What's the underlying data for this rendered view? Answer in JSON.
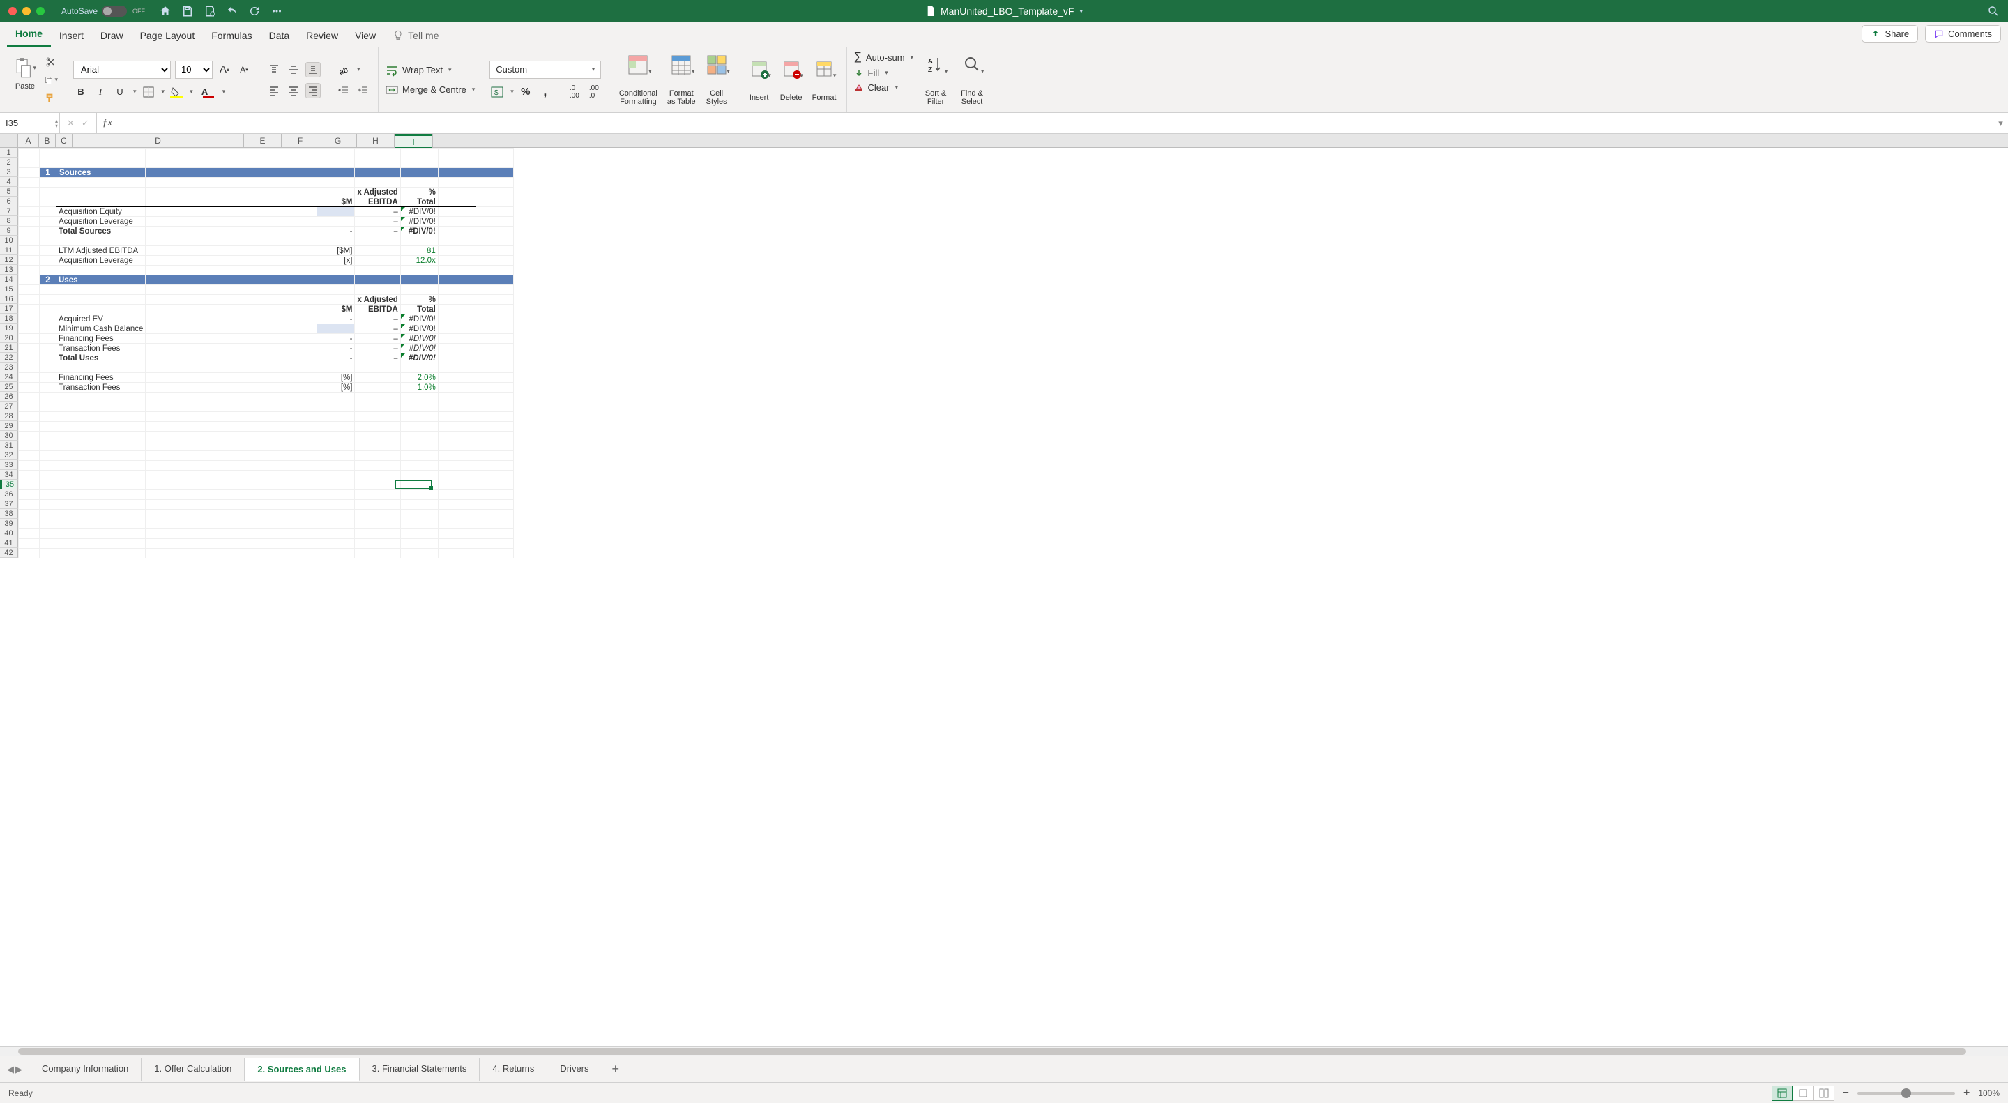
{
  "title_bar": {
    "autosave_label": "AutoSave",
    "autosave_state": "OFF",
    "doc_name": "ManUnited_LBO_Template_vF"
  },
  "menu": {
    "items": [
      "Home",
      "Insert",
      "Draw",
      "Page Layout",
      "Formulas",
      "Data",
      "Review",
      "View"
    ],
    "active_index": 0,
    "tell_me": "Tell me",
    "share": "Share",
    "comments": "Comments"
  },
  "ribbon": {
    "paste": "Paste",
    "font_name": "Arial",
    "font_size": "10",
    "wrap_text": "Wrap Text",
    "merge_centre": "Merge & Centre",
    "number_format": "Custom",
    "cond_fmt": "Conditional\nFormatting",
    "fmt_table": "Format\nas Table",
    "cell_styles": "Cell\nStyles",
    "insert": "Insert",
    "delete": "Delete",
    "format": "Format",
    "autosum": "Auto-sum",
    "fill": "Fill",
    "clear": "Clear",
    "sort": "Sort &\nFilter",
    "find": "Find &\nSelect"
  },
  "name_box": "I35",
  "columns": [
    "A",
    "B",
    "C",
    "D",
    "E",
    "F",
    "G",
    "H",
    "I"
  ],
  "col_widths": {
    "A": 30,
    "B": 24,
    "C": 24,
    "D": 246,
    "E": 54,
    "F": 54,
    "G": 54,
    "H": 54,
    "I": 54
  },
  "rows_visible": 42,
  "sheet": {
    "sections": [
      {
        "num": "1",
        "title": "Sources",
        "row": 3
      },
      {
        "num": "2",
        "title": "Uses",
        "row": 14
      }
    ],
    "header_cols": {
      "E": "$M",
      "F": "x Adjusted EBITDA",
      "G": "% Total"
    },
    "sources": {
      "items": [
        {
          "label": "Acquisition Equity",
          "m": "",
          "x": "–",
          "pct": "#DIV/0!",
          "input_e": true
        },
        {
          "label": "Acquisition Leverage",
          "m": "",
          "x": "–",
          "pct": "#DIV/0!"
        }
      ],
      "total": {
        "label": "Total Sources",
        "m": "-",
        "x": "–",
        "pct": "#DIV/0!"
      },
      "assumptions": [
        {
          "label": "LTM Adjusted EBITDA",
          "unit": "[$M]",
          "val": "81"
        },
        {
          "label": "Acquisition Leverage",
          "unit": "[x]",
          "val": "12.0x"
        }
      ]
    },
    "uses": {
      "items": [
        {
          "label": "Acquired EV",
          "m": "-",
          "x": "–",
          "pct": "#DIV/0!"
        },
        {
          "label": "Minimum Cash Balance",
          "m": "",
          "x": "–",
          "pct": "#DIV/0!",
          "input_e": true
        },
        {
          "label": "Financing Fees",
          "m": "-",
          "x": "–",
          "pct": "#DIV/0!",
          "italic_pct": true
        },
        {
          "label": "Transaction Fees",
          "m": "-",
          "x": "–",
          "pct": "#DIV/0!",
          "italic_pct": true
        }
      ],
      "total": {
        "label": "Total Uses",
        "m": "-",
        "x": "–",
        "pct": "#DIV/0!",
        "italic_pct": true
      },
      "assumptions": [
        {
          "label": "Financing Fees",
          "unit": "[%]",
          "val": "2.0%"
        },
        {
          "label": "Transaction Fees",
          "unit": "[%]",
          "val": "1.0%"
        }
      ]
    }
  },
  "sheet_tabs": {
    "tabs": [
      "Company Information",
      "1. Offer Calculation",
      "2. Sources and Uses",
      "3. Financial Statements",
      "4. Returns",
      "Drivers"
    ],
    "active_index": 2
  },
  "status": {
    "ready": "Ready",
    "zoom": "100%"
  }
}
